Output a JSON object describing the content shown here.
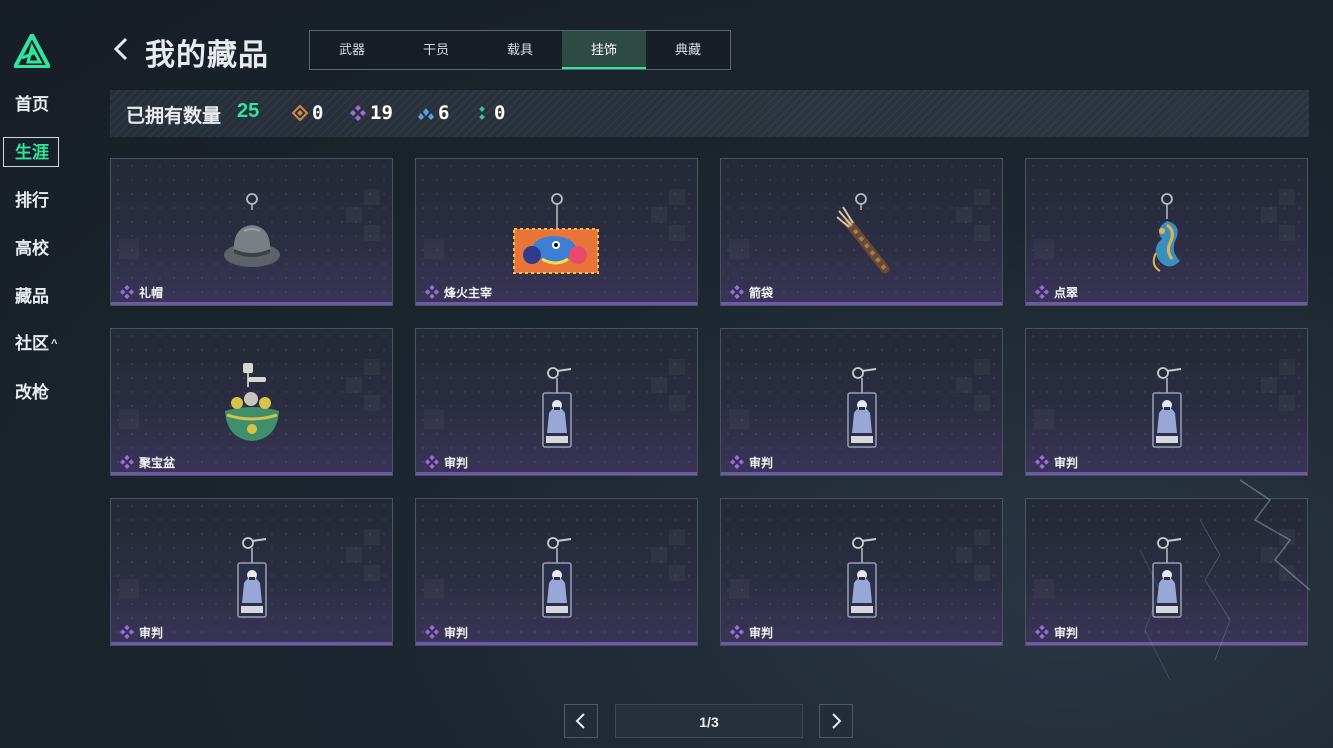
{
  "sidebar": {
    "items": [
      {
        "label": "首页"
      },
      {
        "label": "生涯",
        "active": true
      },
      {
        "label": "排行"
      },
      {
        "label": "高校"
      },
      {
        "label": "藏品"
      },
      {
        "label": "社区",
        "caret": "^"
      },
      {
        "label": "改枪"
      }
    ]
  },
  "header": {
    "title": "我的藏品",
    "tabs": [
      {
        "label": "武器"
      },
      {
        "label": "干员"
      },
      {
        "label": "载具"
      },
      {
        "label": "挂饰",
        "active": true
      },
      {
        "label": "典藏"
      }
    ]
  },
  "stats": {
    "label": "已拥有数量",
    "count": "25",
    "tiers": [
      {
        "icon": "orange-diamond-icon",
        "color": "#d08a4a",
        "value": "0"
      },
      {
        "icon": "purple-diamond-icon",
        "color": "#9b6fe0",
        "value": "19"
      },
      {
        "icon": "blue-tri-icon",
        "color": "#5aa0e6",
        "value": "6"
      },
      {
        "icon": "green-dots-icon",
        "color": "#38c79a",
        "value": "0"
      }
    ]
  },
  "items": [
    {
      "name": "礼帽",
      "art": "top-hat"
    },
    {
      "name": "烽火主宰",
      "art": "graffiti-sign"
    },
    {
      "name": "箭袋",
      "art": "quiver"
    },
    {
      "name": "点翠",
      "art": "phoenix"
    },
    {
      "name": "聚宝盆",
      "art": "treasure-bowl"
    },
    {
      "name": "审判",
      "art": "judgment-card"
    },
    {
      "name": "审判",
      "art": "judgment-card"
    },
    {
      "name": "审判",
      "art": "judgment-card"
    },
    {
      "name": "审判",
      "art": "judgment-card"
    },
    {
      "name": "审判",
      "art": "judgment-card"
    },
    {
      "name": "审判",
      "art": "judgment-card"
    },
    {
      "name": "审判",
      "art": "judgment-card"
    }
  ],
  "pagination": {
    "page": "1/3"
  },
  "colors": {
    "accent": "#2ee59d",
    "rarity_purple": "#9b6fe0"
  }
}
